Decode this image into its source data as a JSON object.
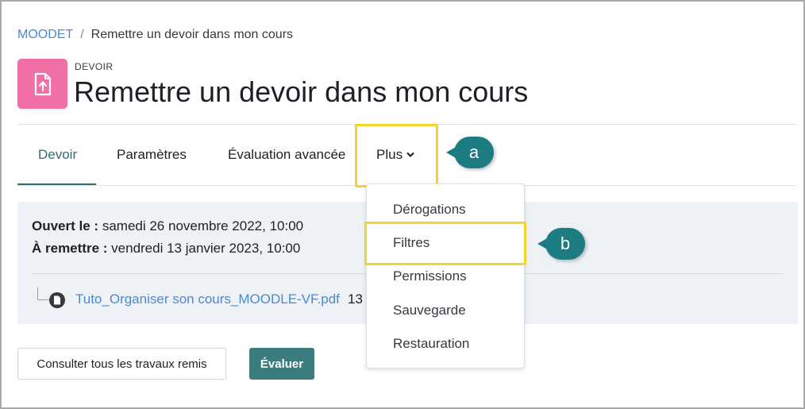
{
  "breadcrumb": {
    "course": "MOODET",
    "separator": "/",
    "current": "Remettre un devoir dans mon cours"
  },
  "activity": {
    "type_label": "DEVOIR",
    "title": "Remettre un devoir dans mon cours",
    "icon": "assignment-upload-icon",
    "icon_color": "#ef6fa6"
  },
  "tabs": [
    {
      "label": "Devoir",
      "active": true
    },
    {
      "label": "Paramètres"
    },
    {
      "label": "Évaluation avancée"
    },
    {
      "label": "Plus",
      "icon": "chevron-down-icon"
    }
  ],
  "dropdown": {
    "items": [
      {
        "label": "Dérogations"
      },
      {
        "label": "Filtres"
      },
      {
        "label": "Permissions"
      },
      {
        "label": "Sauvegarde"
      },
      {
        "label": "Restauration"
      }
    ]
  },
  "callouts": {
    "a": "a",
    "b": "b"
  },
  "dates": {
    "opened_label": "Ouvert le :",
    "opened_value": "samedi 26 novembre 2022, 10:00",
    "due_label": "À remettre :",
    "due_value": "vendredi 13 janvier 2023, 10:00"
  },
  "file": {
    "name": "Tuto_Organiser son cours_MOODLE-VF.pdf",
    "size": "13",
    "icon": "pdf-file-icon"
  },
  "buttons": {
    "view_all": "Consulter tous les travaux remis",
    "grade": "Évaluer"
  },
  "colors": {
    "accent": "#2f6f73",
    "link": "#4a8ad1",
    "highlight": "#f5d32d",
    "callout": "#1d7b82",
    "primary_button": "#3b7d7f"
  }
}
